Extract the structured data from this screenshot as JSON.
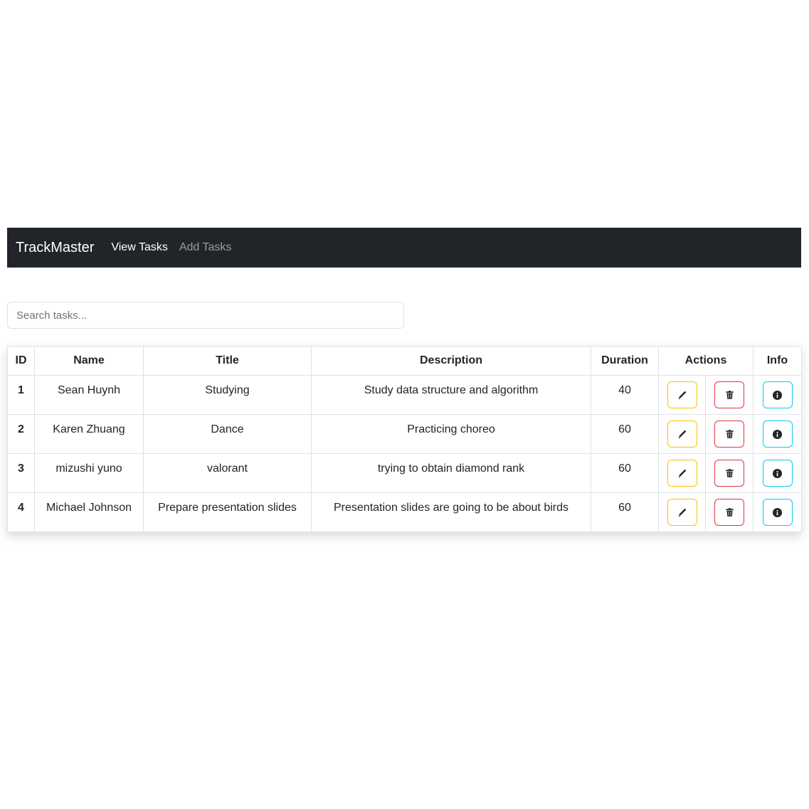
{
  "navbar": {
    "brand": "TrackMaster",
    "links": [
      {
        "label": "View Tasks",
        "active": true
      },
      {
        "label": "Add Tasks",
        "active": false
      }
    ]
  },
  "search": {
    "placeholder": "Search tasks...",
    "value": ""
  },
  "table": {
    "headers": [
      "ID",
      "Name",
      "Title",
      "Description",
      "Duration",
      "Actions",
      "Info"
    ],
    "rows": [
      {
        "id": "1",
        "name": "Sean Huynh",
        "title": "Studying",
        "description": "Study data structure and algorithm",
        "duration": "40"
      },
      {
        "id": "2",
        "name": "Karen Zhuang",
        "title": "Dance",
        "description": "Practicing choreo",
        "duration": "60"
      },
      {
        "id": "3",
        "name": "mizushi yuno",
        "title": "valorant",
        "description": "trying to obtain diamond rank",
        "duration": "60"
      },
      {
        "id": "4",
        "name": "Michael Johnson",
        "title": "Prepare presentation slides",
        "description": "Presentation slides are going to be about birds",
        "duration": "60"
      }
    ]
  },
  "icons": {
    "edit": "pencil-icon",
    "delete": "trash-icon",
    "info": "info-circle-icon"
  },
  "colors": {
    "navbar_bg": "#212529",
    "edit_border": "#ffc107",
    "delete_border": "#dc3545",
    "info_border": "#0dcaf0"
  }
}
